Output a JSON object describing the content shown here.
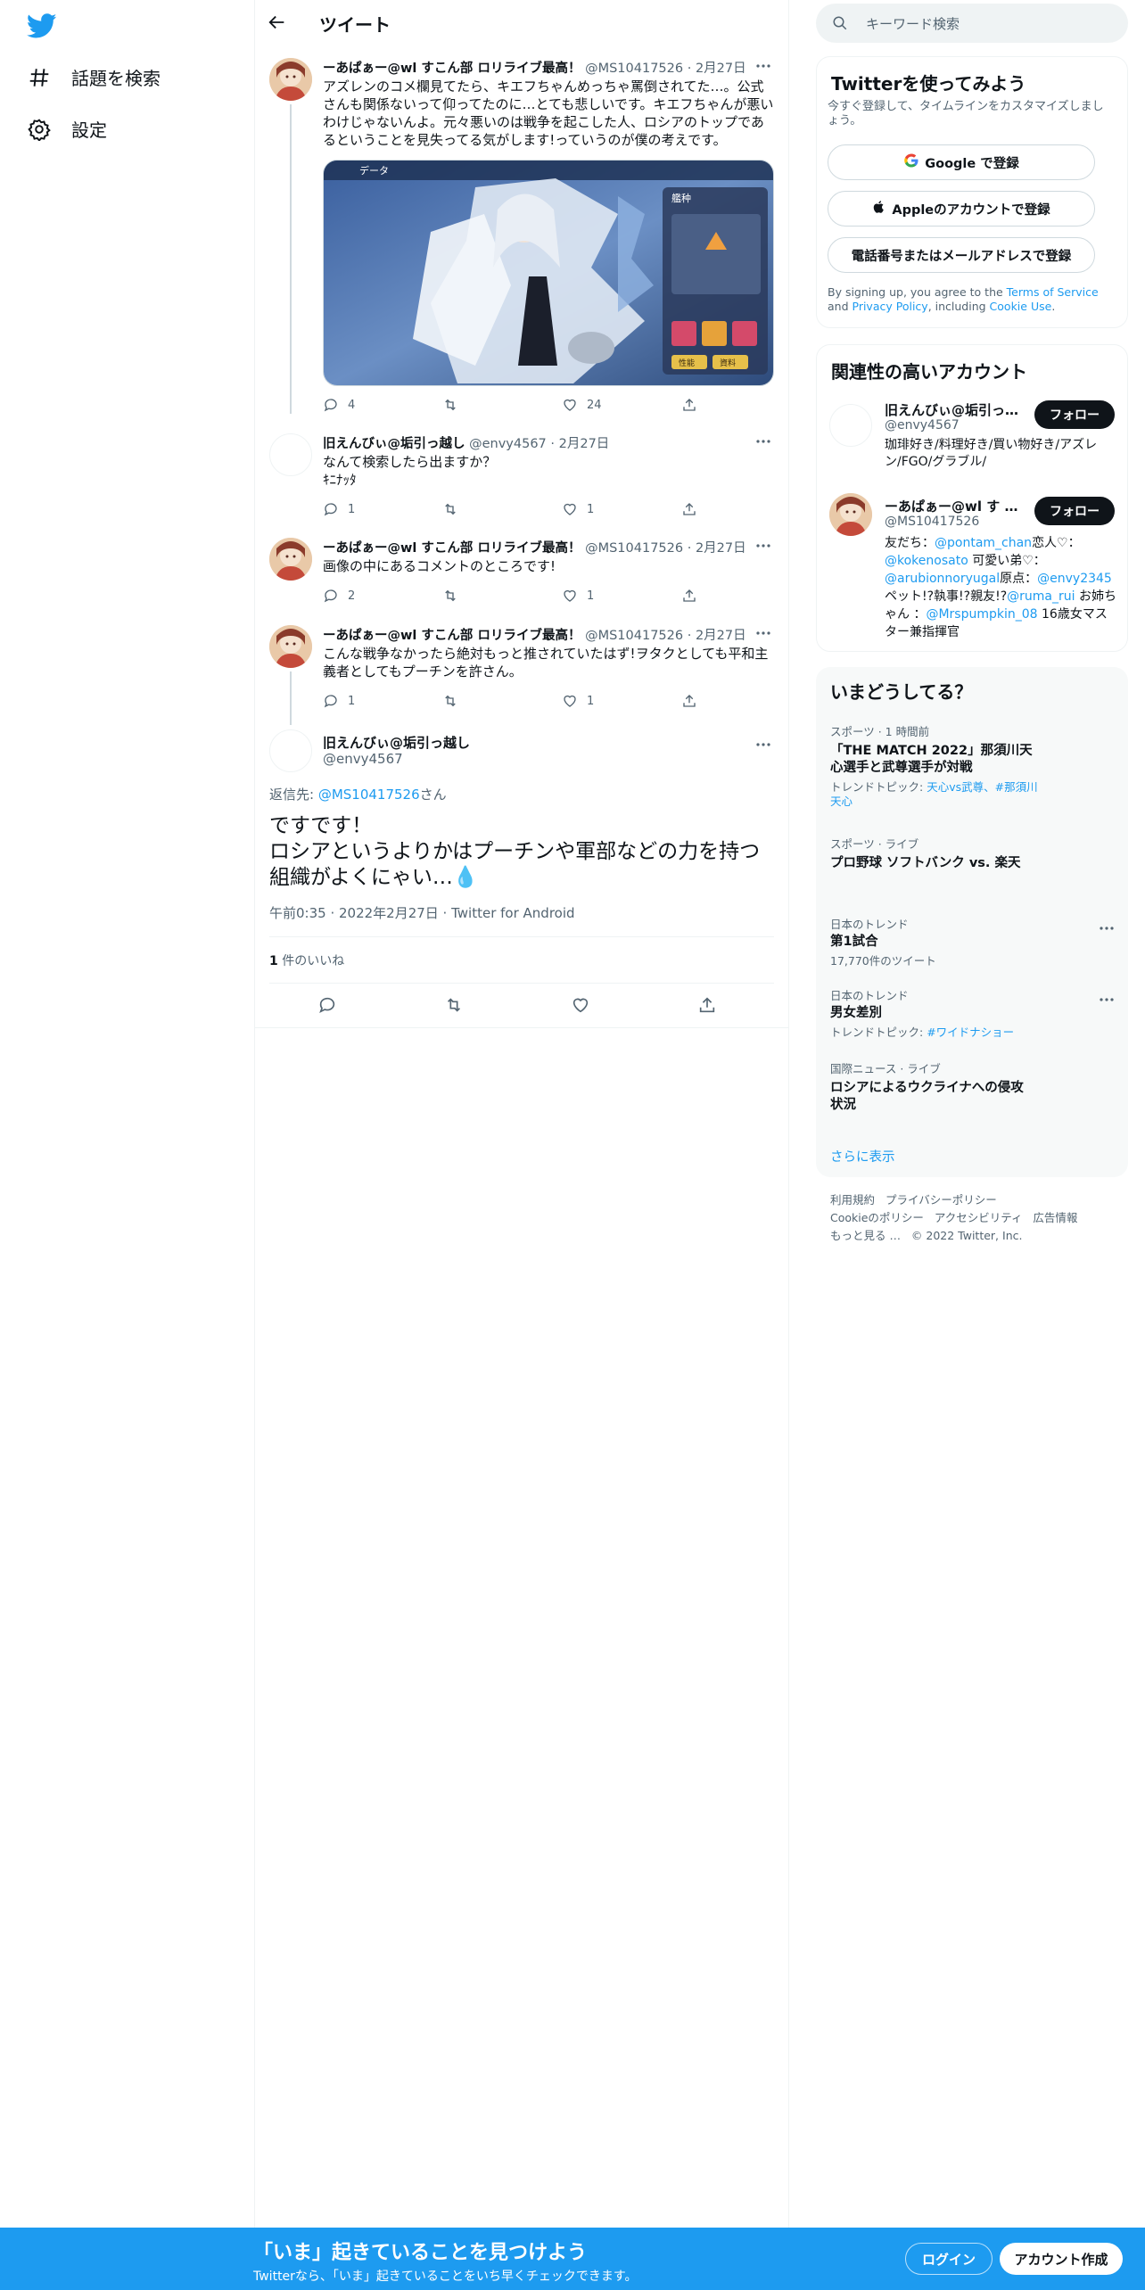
{
  "nav": {
    "explore_label": "話題を検索",
    "settings_label": "設定"
  },
  "header": {
    "title": "ツイート"
  },
  "tweets": [
    {
      "name": "ーあぱぁー@wl すこん部 ロリライブ最高！",
      "handle": "@MS10417526",
      "date": "2月27日",
      "text": "アズレンのコメ欄見てたら、キエフちゃんめっちゃ罵倒されてた…。公式さんも関係ないって仰ってたのに…とても悲しいです。キエフちゃんが悪いわけじゃないんよ。元々悪いのは戦争を起こした人、ロシアのトップであるということを見失ってる気がします!っていうのが僕の考えです。",
      "replies": "4",
      "retweets": "",
      "likes": "24",
      "media": {
        "top_label": "データ",
        "right_label": "艦种",
        "btn1": "性能",
        "btn2": "資料"
      }
    },
    {
      "name": "旧えんびぃ@垢引っ越し",
      "handle": "@envy4567",
      "date": "2月27日",
      "text": "なんて検索したら出ますか？\nｷﾆﾅｯﾀ",
      "replies": "1",
      "retweets": "",
      "likes": "1"
    },
    {
      "name": "ーあぱぁー@wl すこん部 ロリライブ最高！",
      "handle": "@MS10417526",
      "date": "2月27日",
      "text": "画像の中にあるコメントのところです!",
      "replies": "2",
      "retweets": "",
      "likes": "1"
    },
    {
      "name": "ーあぱぁー@wl すこん部 ロリライブ最高！",
      "handle": "@MS10417526",
      "date": "2月27日",
      "text": "こんな戦争なかったら絶対もっと推されていたはず!ヲタクとしても平和主義者としてもプーチンを許さん。",
      "replies": "1",
      "retweets": "",
      "likes": "1"
    }
  ],
  "main_tweet": {
    "name": "旧えんびぃ@垢引っ越し",
    "handle": "@envy4567",
    "reply_prefix": "返信先: ",
    "reply_to": "@MS10417526",
    "reply_suffix": "さん",
    "text": "ですです！\nロシアというよりかはプーチンや軍部などの力を持つ組織がよくにゃい…💧",
    "meta": "午前0:35 · 2022年2月27日 · Twitter for Android",
    "likes_count": "1",
    "likes_label": " 件のいいね"
  },
  "search": {
    "placeholder": "キーワード検索"
  },
  "signup": {
    "title": "Twitterを使ってみよう",
    "subtitle": "今すぐ登録して、タイムラインをカスタマイズしましょう。",
    "google": "Google で登録",
    "apple": "Appleのアカウントで登録",
    "phone": "電話番号またはメールアドレスで登録",
    "terms_prefix": "By signing up, you agree to the ",
    "terms_link": "Terms of Service",
    "terms_and": " and ",
    "privacy_link": "Privacy Policy",
    "terms_incl": ", including ",
    "cookie_link": "Cookie Use",
    "terms_end": "."
  },
  "related": {
    "title": "関連性の高いアカウント",
    "follow_label": "フォロー",
    "accounts": [
      {
        "name": "旧えんびぃ@垢引っ…",
        "handle": "@envy4567",
        "bio": "珈琲好き/料理好き/買い物好き/アズレン/FGO/グラブル/"
      },
      {
        "name": "ーあぱぁー@wl す こ…",
        "handle": "@MS10417526",
        "bio_1": "友だち：",
        "bio_link_1": "@pontam_chan",
        "bio_2": "恋人♡：",
        "bio_link_2": "@kokenosato",
        "bio_3": " 可愛い弟♡：",
        "bio_link_3": "@arubionnoryugal",
        "bio_4": "原点：",
        "bio_link_4": "@envy2345",
        "bio_5": " ペット!?執事!?親友!?",
        "bio_link_5": "@ruma_rui",
        "bio_6": " お姉ちゃん ：",
        "bio_link_6": "@Mrspumpkin_08",
        "bio_7": " 16歳女マスター兼指揮官"
      }
    ]
  },
  "trends": {
    "title": "いまどうしてる？",
    "items": [
      {
        "category": "スポーツ · 1 時間前",
        "title": "「THE MATCH 2022」那須川天心選手と武尊選手が対戦",
        "sub_prefix": "トレンドトピック: ",
        "sub_link": "天心vs武尊、#那須川天心"
      },
      {
        "category": "スポーツ · ライブ",
        "title": "プロ野球 ソフトバンク vs. 楽天"
      },
      {
        "category": "日本のトレンド",
        "title": "第1試合",
        "sub": "17,770件のツイート"
      },
      {
        "category": "日本のトレンド",
        "title": "男女差別",
        "sub_prefix": "トレンドトピック: ",
        "sub_link": "#ワイドナショー"
      },
      {
        "category": "国際ニュース · ライブ",
        "title": "ロシアによるウクライナへの侵攻状況"
      }
    ],
    "show_more": "さらに表示"
  },
  "footer": {
    "terms": "利用規約",
    "privacy": "プライバシーポリシー",
    "cookie": "Cookieのポリシー",
    "accessibility": "アクセシビリティ",
    "ads": "広告情報",
    "more": "もっと見る …",
    "copyright": "© 2022 Twitter, Inc."
  },
  "bottom_bar": {
    "title": "「いま」起きていることを見つけよう",
    "subtitle": "Twitterなら、「いま」起きていることをいち早くチェックできます。",
    "login": "ログイン",
    "signup": "アカウント作成"
  },
  "colors": {
    "accent": "#1d9bf0",
    "text": "#0f1419",
    "muted": "#536471",
    "border": "#eff3f4"
  }
}
